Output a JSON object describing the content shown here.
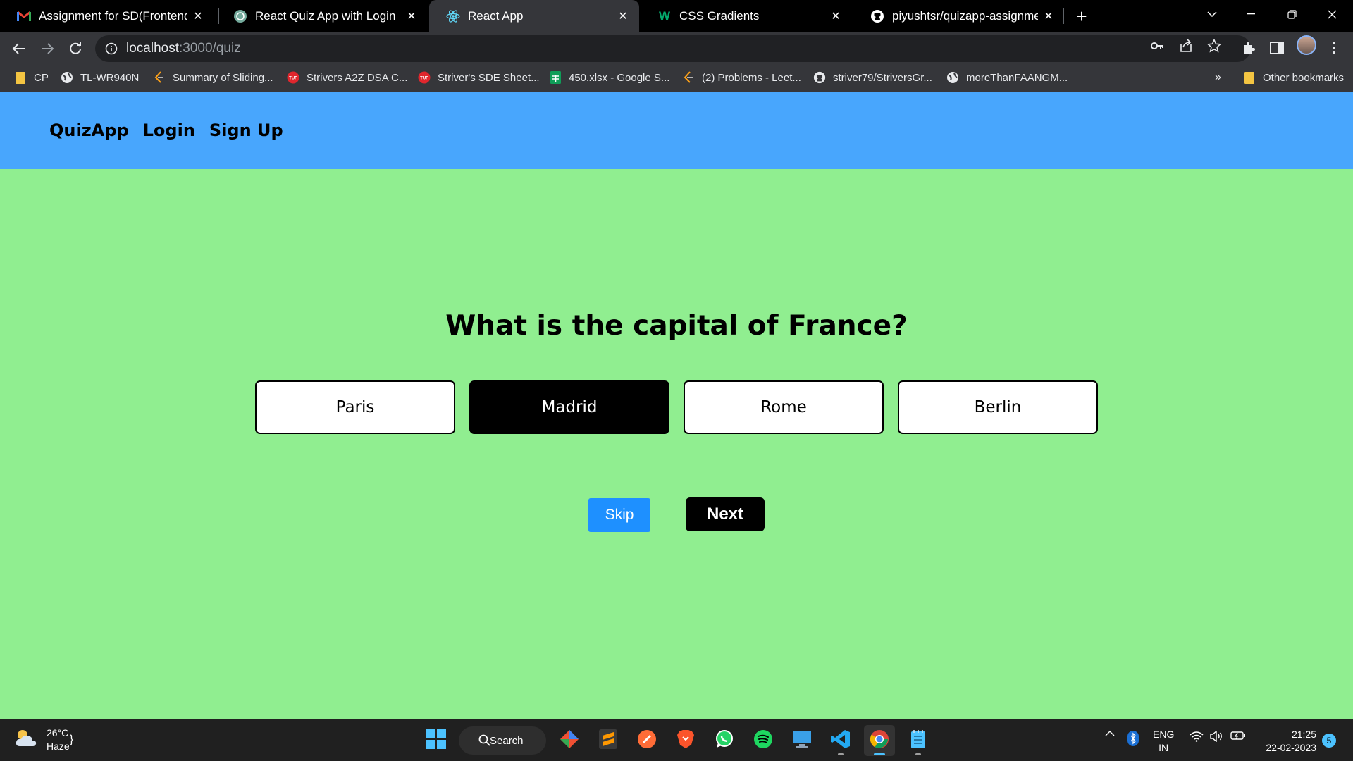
{
  "browser": {
    "tabs": [
      {
        "title": "Assignment for SD(Frontend) Inte",
        "icon": "gmail-icon",
        "active": false
      },
      {
        "title": "React Quiz App with Login",
        "icon": "chatgpt-icon",
        "active": false
      },
      {
        "title": "React App",
        "icon": "react-icon",
        "active": true
      },
      {
        "title": "CSS Gradients",
        "icon": "w3schools-icon",
        "active": false
      },
      {
        "title": "piyushtsr/quizapp-assignment",
        "icon": "github-icon",
        "active": false
      }
    ],
    "url_host": "localhost",
    "url_path": ":3000/quiz",
    "bookmarks": [
      {
        "label": "CP",
        "icon": "folder-icon"
      },
      {
        "label": "TL-WR940N",
        "icon": "globe-icon"
      },
      {
        "label": "Summary of Sliding...",
        "icon": "leetcode-icon"
      },
      {
        "label": "Strivers A2Z DSA C...",
        "icon": "tuf-icon"
      },
      {
        "label": "Striver's SDE Sheet...",
        "icon": "tuf-icon"
      },
      {
        "label": "450.xlsx - Google S...",
        "icon": "sheets-icon"
      },
      {
        "label": "(2) Problems - Leet...",
        "icon": "leetcode-icon"
      },
      {
        "label": "striver79/StriversGr...",
        "icon": "github-icon"
      },
      {
        "label": "moreThanFAANGM...",
        "icon": "globe-icon"
      }
    ],
    "more_bookmarks": "»",
    "other_bookmarks": "Other bookmarks"
  },
  "app": {
    "nav": {
      "brand": "QuizApp",
      "login": "Login",
      "signup": "Sign Up"
    },
    "question": "What is the capital of France?",
    "options": [
      "Paris",
      "Madrid",
      "Rome",
      "Berlin"
    ],
    "selected_option": "Madrid",
    "skip_label": "Skip",
    "next_label": "Next"
  },
  "taskbar": {
    "weather_temp": "26°C",
    "weather_desc": "Haze",
    "search_label": "Search",
    "lang_line1": "ENG",
    "lang_line2": "IN",
    "time": "21:25",
    "date": "22-02-2023",
    "notification_count": "5"
  },
  "colors": {
    "page_bg": "#90ee90",
    "navbar_bg": "#48a6fd",
    "skip_bg": "#1e90ff",
    "selected_option_bg": "#000000"
  }
}
